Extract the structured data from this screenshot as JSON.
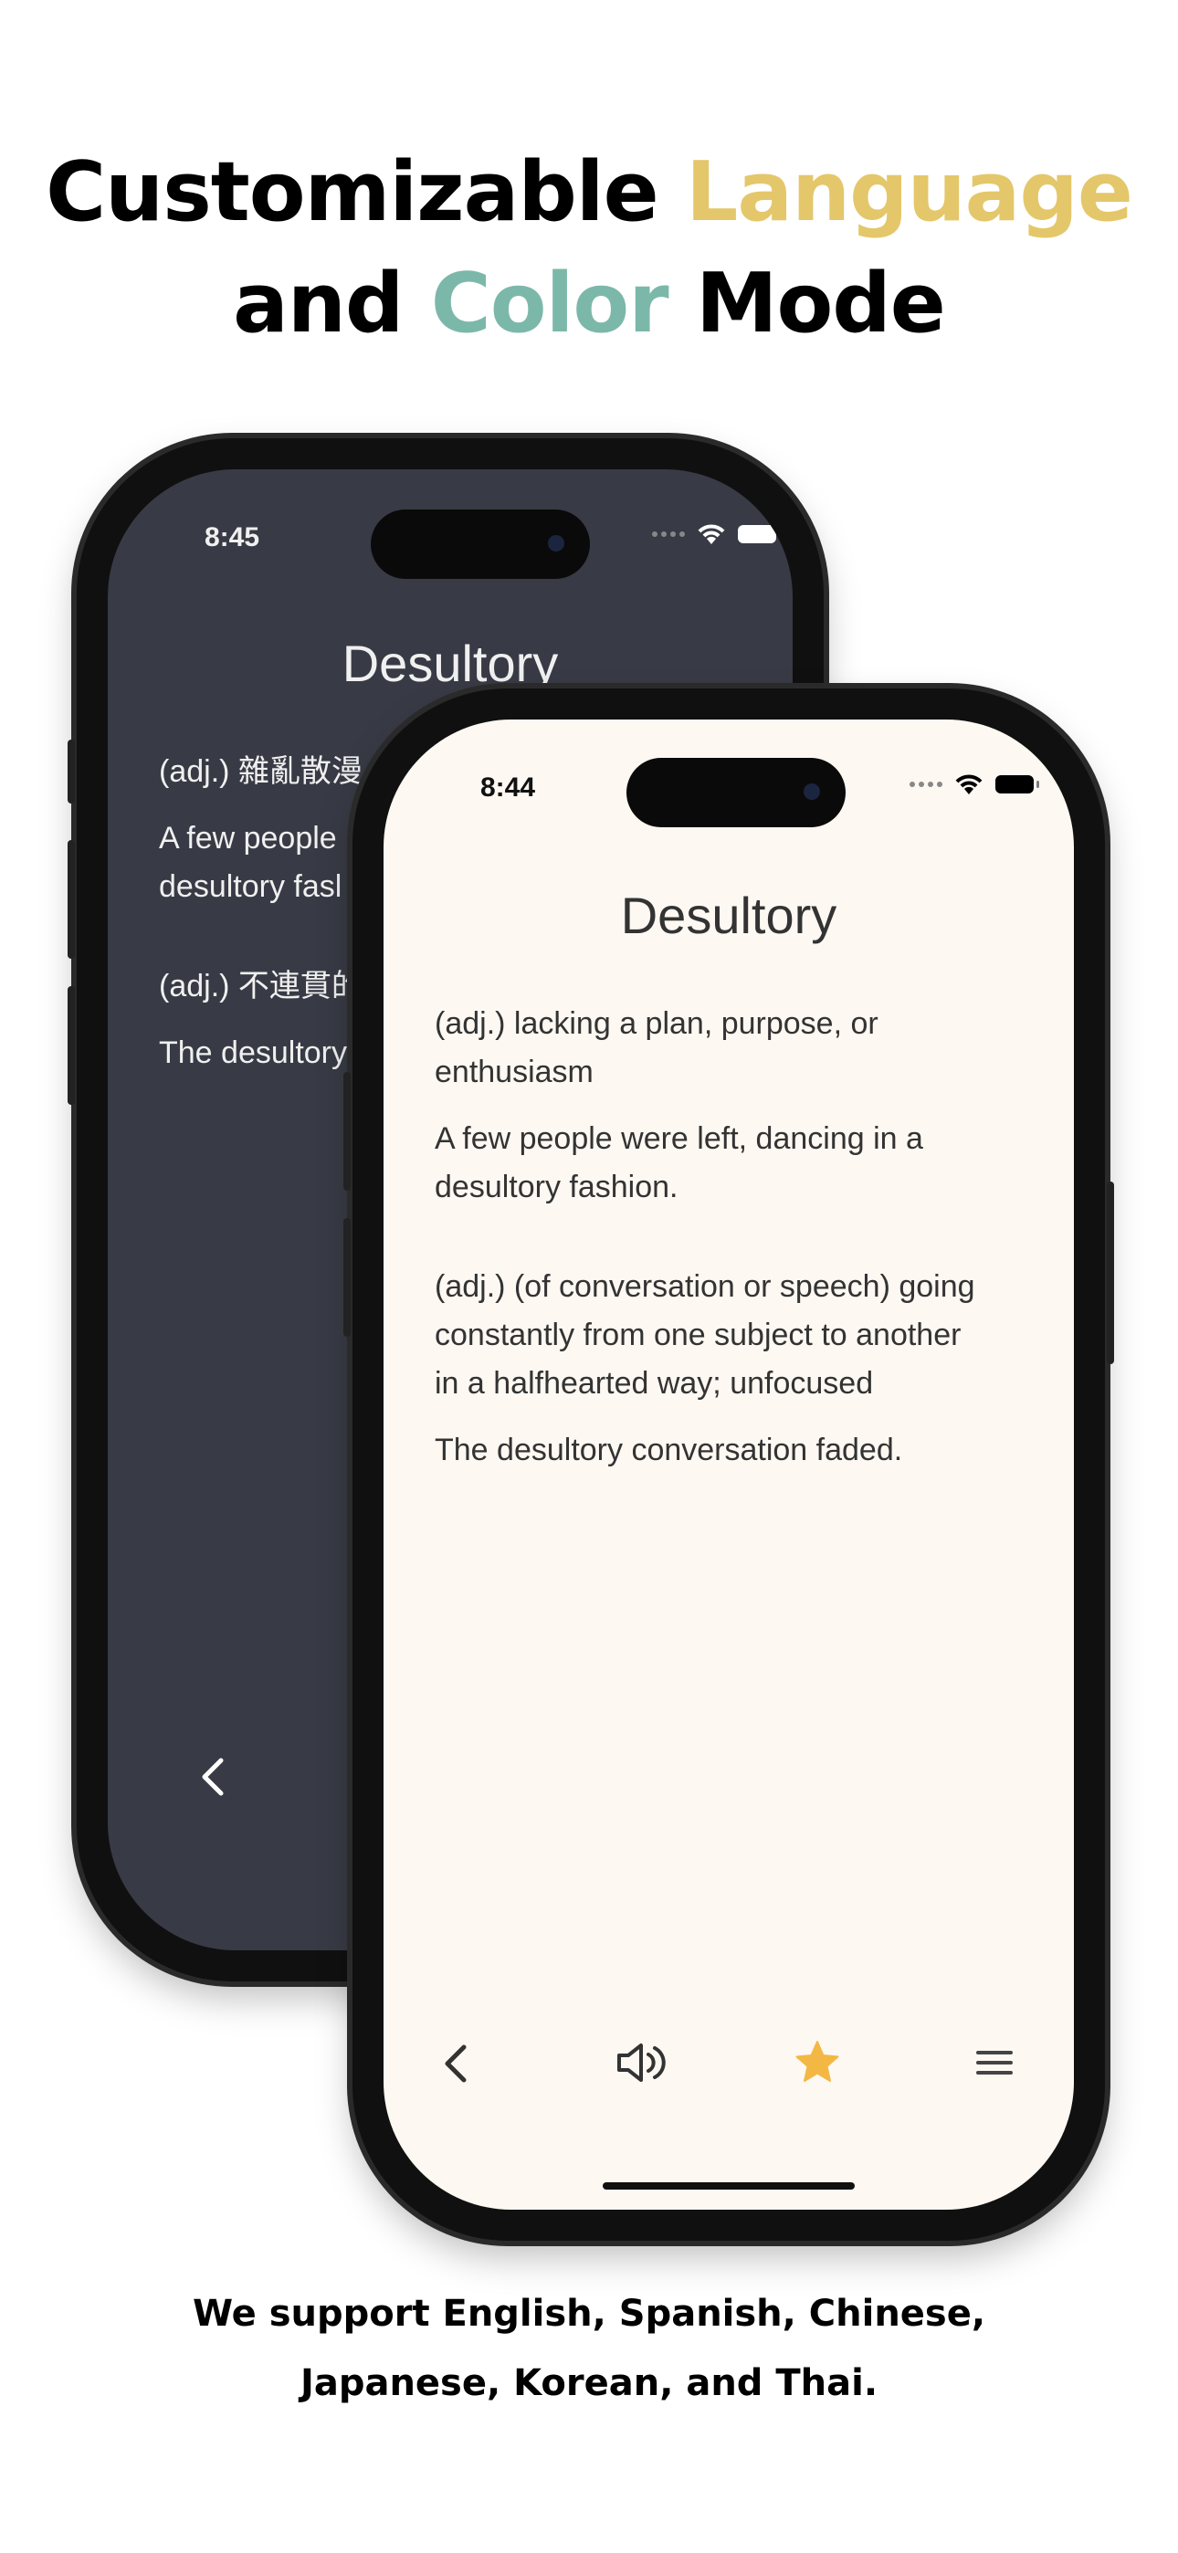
{
  "headline": {
    "line1_black": "Customizable ",
    "line1_yellow": "Language",
    "line2_black_a": "and ",
    "line2_teal": "Color",
    "line2_black_b": " Mode",
    "colors": {
      "yellow": "#e4c76a",
      "teal": "#7cb8aa"
    }
  },
  "dark_phone": {
    "time": "8:45",
    "title": "Desultory",
    "def1": "(adj.) 雜亂散漫",
    "example1_line1": "A few people",
    "example1_line2": "desultory fasl",
    "def2": "(adj.) 不連貫的",
    "example2": "The desultory",
    "theme": {
      "background": "#383b45",
      "text": "#f0f0f0"
    }
  },
  "light_phone": {
    "time": "8:44",
    "title": "Desultory",
    "def1_line1": "(adj.) lacking a plan, purpose, or",
    "def1_line2": "enthusiasm",
    "example1_line1": "A few people were left, dancing in a",
    "example1_line2": "desultory fashion.",
    "def2_line1": "(adj.) (of conversation or speech) going",
    "def2_line2": "constantly from one subject to another",
    "def2_line3": "in a halfhearted way; unfocused",
    "example2": "The desultory conversation faded.",
    "toolbar": [
      "back-icon",
      "speaker-icon",
      "star-icon",
      "menu-icon"
    ],
    "theme": {
      "background": "#fdf8f2",
      "text": "#333333",
      "star": "#f3b844"
    }
  },
  "footer": {
    "line1": "We support English, Spanish, Chinese,",
    "line2": "Japanese, Korean, and Thai."
  }
}
